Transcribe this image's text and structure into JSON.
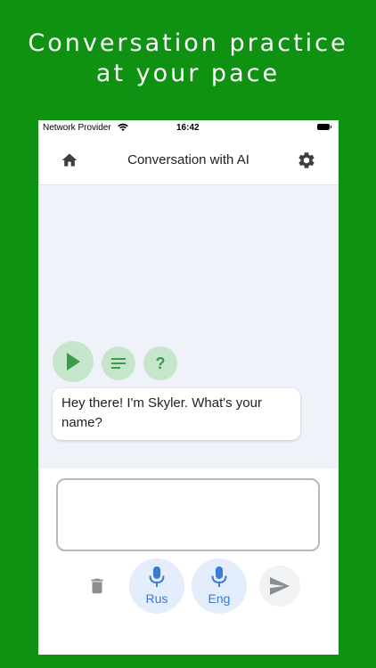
{
  "promo": {
    "headline_line1": "Conversation practice",
    "headline_line2": "at your pace"
  },
  "status_bar": {
    "carrier": "Network Provider",
    "time": "16:42"
  },
  "app_bar": {
    "title": "Conversation with AI",
    "left_icon": "home-icon",
    "right_icon": "gear-icon"
  },
  "chat": {
    "controls": [
      "play-icon",
      "text-lines-icon",
      "question-mark-icon"
    ],
    "help_glyph": "?",
    "message": "Hey there! I'm Skyler. What's your name?"
  },
  "input": {
    "value": ""
  },
  "bottom_controls": {
    "mic_rus_label": "Rus",
    "mic_eng_label": "Eng",
    "icons": [
      "trash-icon",
      "microphone-icon",
      "send-icon"
    ]
  },
  "colors": {
    "background": "#0f9112",
    "accent_green": "#3b9b48",
    "accent_blue": "#3a7bd5",
    "chat_bg": "#eff3f9"
  }
}
